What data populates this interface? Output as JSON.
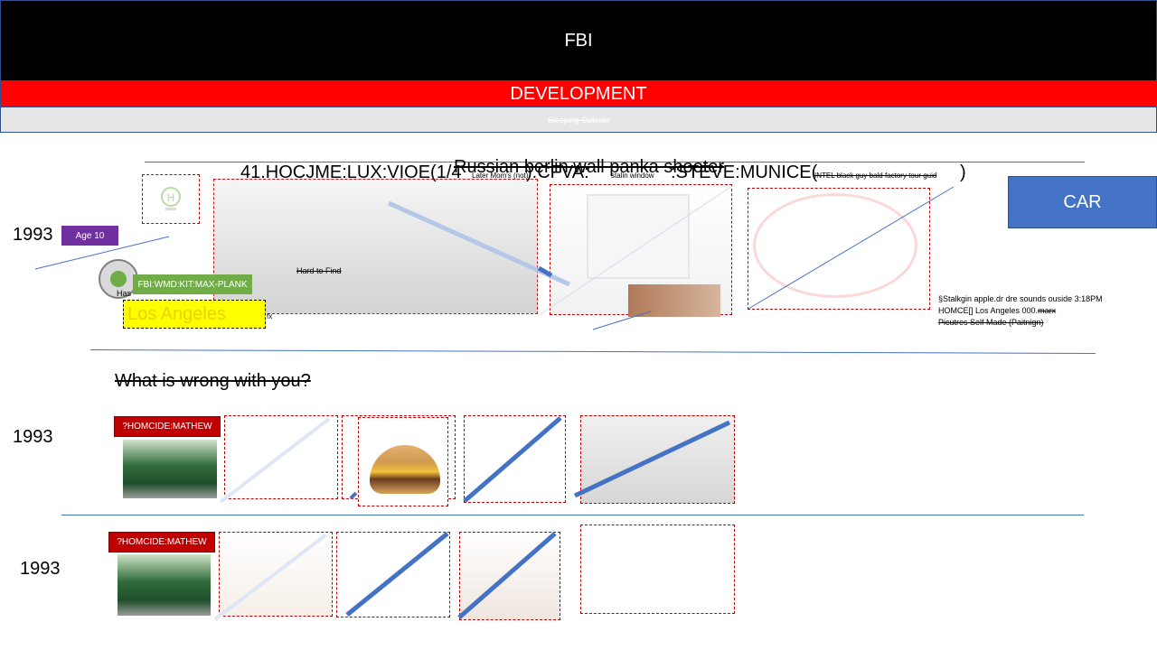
{
  "header": {
    "title": "FBI",
    "subtitle": "DEVELOPMENT",
    "subbar": "Sleeping Outside"
  },
  "car_button": {
    "label": "CAR"
  },
  "row1": {
    "year": "1993",
    "age_badge": "Age 10",
    "title_left": "41.HOCJME:LUX:VIOE(1/4",
    "title_right": ").CFVA:",
    "title_end": ":STEVE:MUNICE(",
    "title_close": ")",
    "title_overlay": "Russian berlin wall panka shooter",
    "tiny_left": "Later Mom's (not)",
    "tiny_mid": "stalin window",
    "tiny_right": "INTEL black guy bald factory tour guid",
    "hard_to_find": "Hard to Find",
    "fbi_tag": "FBI:WMD:KIT:MAX-PLANK",
    "la_label": "Los Angeles",
    "has_label": "Has",
    "fx_label": "fx",
    "notes": {
      "line1": "§Stalkgin apple.dr dre sounds ouside 3:18PM",
      "line2": "HOMCE[] Los Angeles 000.",
      "line2_strike": "marx",
      "line3": "Picutres Self Made (Paitnign)"
    }
  },
  "question": "What is wrong with you?",
  "row2": {
    "year": "1993",
    "tag": "?HOMCIDE:MATHEW"
  },
  "row3": {
    "year": "1993",
    "tag": "?HOMCIDE:MATHEW"
  },
  "colors": {
    "accent": "#4472c4",
    "red": "#ff0000",
    "dark_red": "#c00000",
    "purple": "#7030a0",
    "green": "#70ad47",
    "yellow": "#ffff00"
  }
}
